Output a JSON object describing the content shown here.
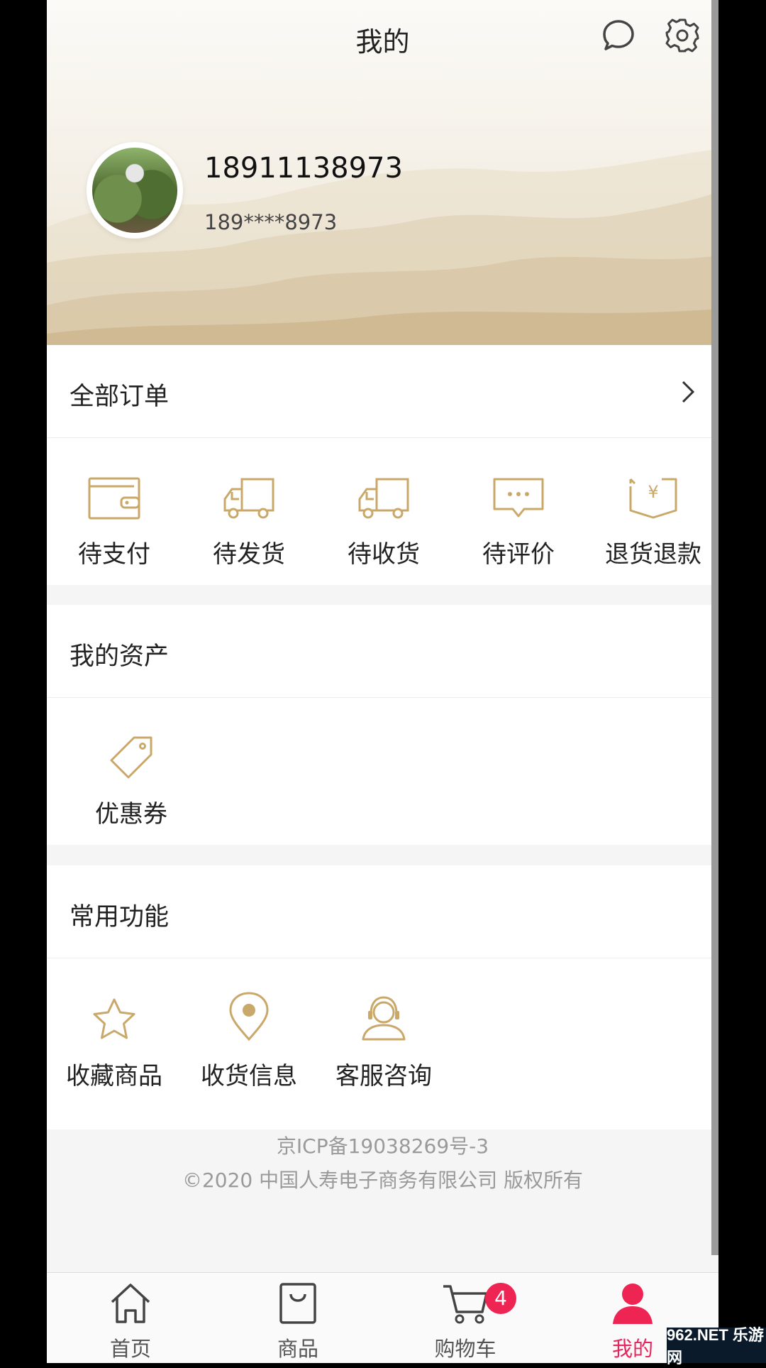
{
  "header": {
    "title": "我的",
    "username": "18911138973",
    "phone_masked": "189****8973"
  },
  "orders": {
    "title": "全部订单",
    "items": [
      {
        "label": "待支付",
        "icon": "wallet-icon"
      },
      {
        "label": "待发货",
        "icon": "truck-icon"
      },
      {
        "label": "待收货",
        "icon": "truck-icon"
      },
      {
        "label": "待评价",
        "icon": "comment-icon"
      },
      {
        "label": "退货退款",
        "icon": "refund-icon"
      }
    ]
  },
  "assets": {
    "title": "我的资产",
    "items": [
      {
        "label": "优惠券",
        "icon": "coupon-tag-icon"
      }
    ]
  },
  "functions": {
    "title": "常用功能",
    "items": [
      {
        "label": "收藏商品",
        "icon": "star-icon"
      },
      {
        "label": "收货信息",
        "icon": "location-pin-icon"
      },
      {
        "label": "客服咨询",
        "icon": "customer-service-icon"
      }
    ]
  },
  "footer": {
    "icp": "京ICP备19038269号-3",
    "copyright": "©2020 中国人寿电子商务有限公司 版权所有"
  },
  "tabbar": {
    "items": [
      {
        "label": "首页",
        "icon": "home-icon"
      },
      {
        "label": "商品",
        "icon": "shopping-bag-icon"
      },
      {
        "label": "购物车",
        "icon": "cart-icon"
      },
      {
        "label": "我的",
        "icon": "user-icon"
      }
    ],
    "cart_badge": "4",
    "active": "我的"
  },
  "watermark": "962.NET 乐游网",
  "colors": {
    "accent_gold": "#c9a86a",
    "active_pink": "#e8265b",
    "badge_red": "#ee2453"
  }
}
